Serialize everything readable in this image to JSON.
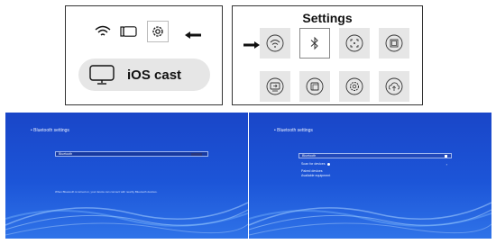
{
  "settings_panel": {
    "title": "Settings",
    "tiles": [
      {
        "icon": "wifi-icon"
      },
      {
        "icon": "bluetooth-icon",
        "selected": true
      },
      {
        "icon": "screen-focus-icon"
      },
      {
        "icon": "keystone-icon"
      },
      {
        "icon": "input-source-icon"
      },
      {
        "icon": "display-icon"
      },
      {
        "icon": "settings-gear-icon"
      },
      {
        "icon": "upgrade-icon"
      }
    ]
  },
  "home_panel": {
    "cast_label": "iOS cast"
  },
  "screen_left": {
    "title": "• Bluetooth settings",
    "bluetooth_label": "Bluetooth",
    "hint": "When Bluetooth is turned on, your device can connect with nearby Bluetooth devices."
  },
  "screen_right": {
    "title": "• Bluetooth settings",
    "bluetooth_label": "Bluetooth",
    "scan_label": "Scan for devices",
    "paired_label": "Paired devices",
    "available_label": "Available equipment"
  }
}
